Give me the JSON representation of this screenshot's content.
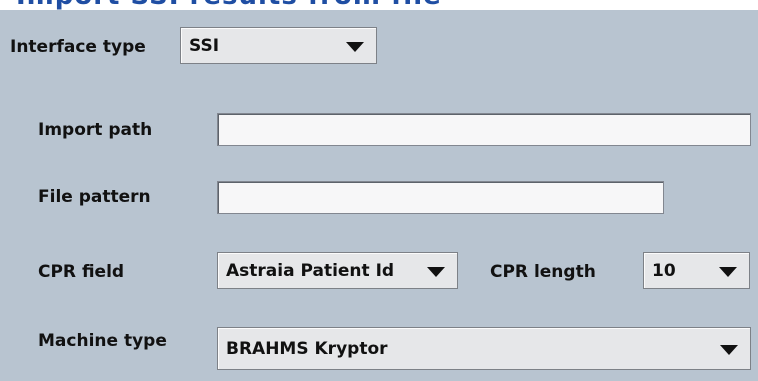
{
  "header": {
    "title": "Import SSI results from file"
  },
  "form": {
    "interface_type": {
      "label": "Interface type",
      "value": "SSI"
    },
    "import_path": {
      "label": "Import path",
      "value": ""
    },
    "file_pattern": {
      "label": "File pattern",
      "value": ""
    },
    "cpr_field": {
      "label": "CPR field",
      "value": "Astraia Patient Id"
    },
    "cpr_length": {
      "label": "CPR length",
      "value": "10"
    },
    "machine_type": {
      "label": "Machine type",
      "value": "BRAHMS Kryptor"
    }
  },
  "colors": {
    "panel_bg": "#b8c4d0",
    "header_text": "#1f4ea3",
    "control_bg": "#e6e7e9"
  },
  "icons": {
    "dropdown": "triangle-down-icon"
  }
}
